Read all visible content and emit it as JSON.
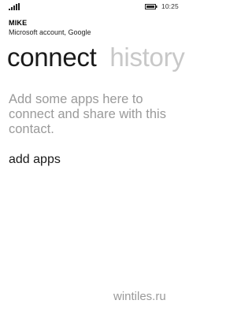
{
  "status_bar": {
    "time": "10:25",
    "signal_icon": "signal-bars-icon",
    "battery_icon": "battery-icon"
  },
  "contact": {
    "name": "MIKE",
    "accounts": "Microsoft account, Google"
  },
  "pivot": {
    "tabs": [
      {
        "label": "connect",
        "active": true
      },
      {
        "label": "history",
        "active": false
      }
    ]
  },
  "main": {
    "empty_message": "Add some apps here to connect and share with this contact.",
    "add_apps_label": "add apps"
  },
  "watermark": "wintiles.ru",
  "colors": {
    "background": "#ffffff",
    "text": "#1a1a1a",
    "muted_text": "#9a9a9a",
    "inactive_tab": "#c8c8c8"
  }
}
